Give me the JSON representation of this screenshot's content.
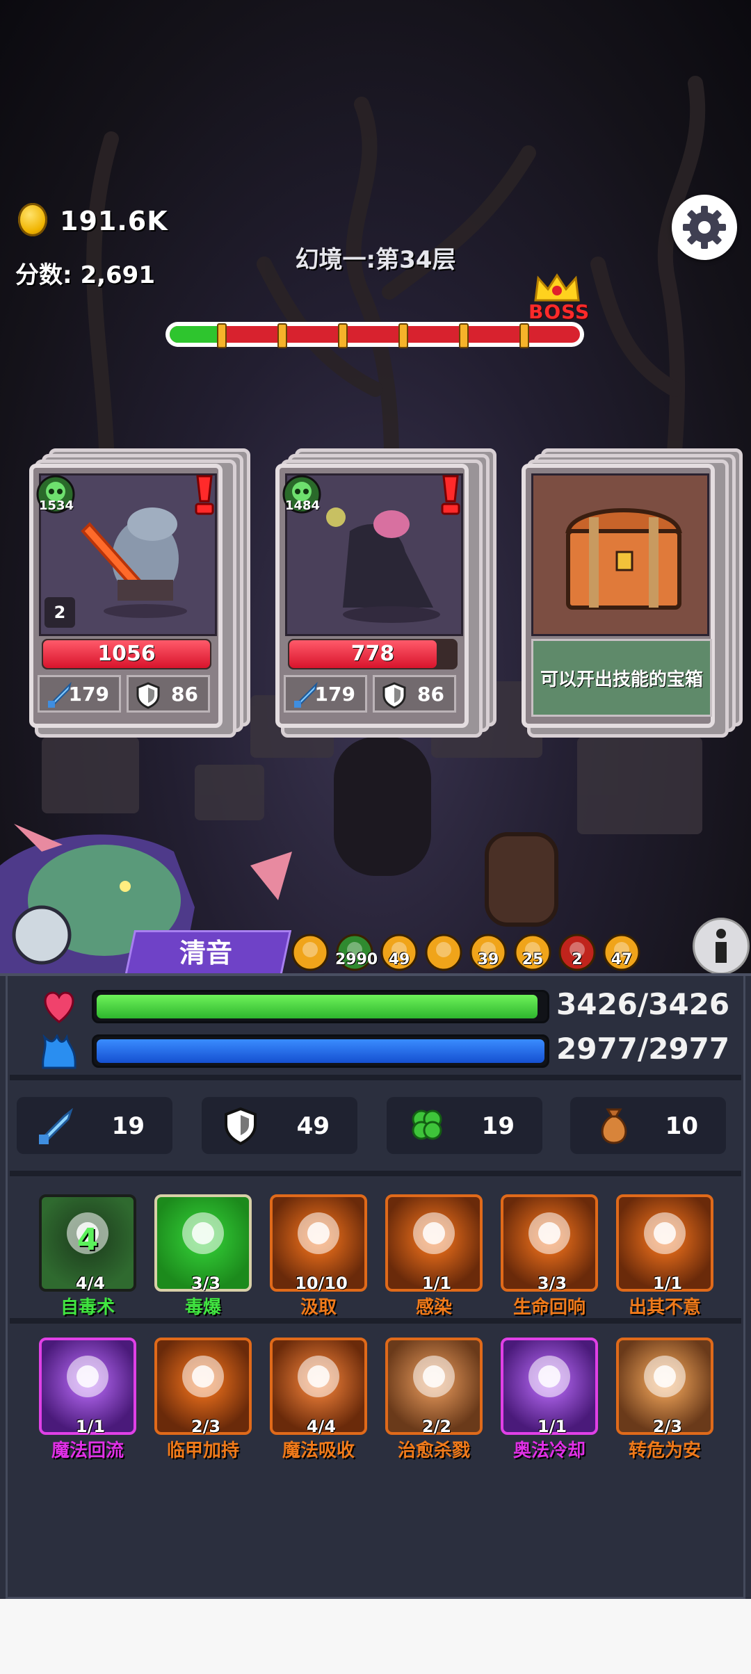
{
  "hud": {
    "gold": "191.6K",
    "score_label": "分数:",
    "score": "2,691",
    "level_title": "幻境一:第34层",
    "boss_label": "BOSS",
    "stage_progress": 0.13,
    "stage_markers": 6
  },
  "enemies": [
    {
      "level": "1534",
      "hp": "1056",
      "hp_ratio": 1.0,
      "attack": "179",
      "defense": "86",
      "count": "2"
    },
    {
      "level": "1484",
      "hp": "778",
      "hp_ratio": 0.88,
      "attack": "179",
      "defense": "86",
      "count": ""
    }
  ],
  "chest": {
    "description": "可以开出技能的宝箱"
  },
  "hero": {
    "name": "清音",
    "buffs": [
      {
        "icon": "figure-buff-icon",
        "value": ""
      },
      {
        "icon": "poison-skull-buff-icon",
        "value": "2990"
      },
      {
        "icon": "shield-buff-icon",
        "value": "49"
      },
      {
        "icon": "fist-buff-icon",
        "value": ""
      },
      {
        "icon": "fist-buff-icon",
        "value": "39"
      },
      {
        "icon": "fist-buff-icon",
        "value": "25"
      },
      {
        "icon": "fire-buff-icon",
        "value": "2"
      },
      {
        "icon": "fist-buff-icon",
        "value": "47"
      }
    ]
  },
  "stats": {
    "hp": "3426/3426",
    "mp": "2977/2977",
    "attack": "19",
    "defense": "49",
    "luck": "19",
    "gold_bag": "10"
  },
  "skills_row1": [
    {
      "name": "自毒术",
      "count": "4/4",
      "badge": "4",
      "icon": "poison-skull-icon"
    },
    {
      "name": "毒爆",
      "count": "3/3",
      "icon": "poison-face-icon"
    },
    {
      "name": "汲取",
      "count": "10/10",
      "icon": "drain-cross-icon"
    },
    {
      "name": "感染",
      "count": "1/1",
      "icon": "splash-infect-icon"
    },
    {
      "name": "生命回响",
      "count": "3/3",
      "icon": "muscle-arm-icon"
    },
    {
      "name": "出其不意",
      "count": "1/1",
      "icon": "dash-strike-icon"
    }
  ],
  "skills_row2": [
    {
      "name": "魔法回流",
      "count": "1/1",
      "icon": "mana-flow-icon"
    },
    {
      "name": "临甲加持",
      "count": "2/3",
      "icon": "armor-runner-icon"
    },
    {
      "name": "魔法吸收",
      "count": "4/4",
      "icon": "caduceus-icon"
    },
    {
      "name": "治愈杀戮",
      "count": "2/2",
      "icon": "heal-slaughter-icon"
    },
    {
      "name": "奥法冷却",
      "count": "1/1",
      "icon": "arcane-cooldown-icon"
    },
    {
      "name": "转危为安",
      "count": "2/3",
      "icon": "turn-safe-icon"
    }
  ],
  "colors": {
    "hp_bar": "#43d43a",
    "mp_bar": "#1f6cf2",
    "panel_bg": "#2b2f3e",
    "green_skill_label": "#41e641",
    "orange_skill_label": "#f07a1a",
    "magenta_skill_label": "#e030e6",
    "hero_tab": "#6f42c7"
  }
}
